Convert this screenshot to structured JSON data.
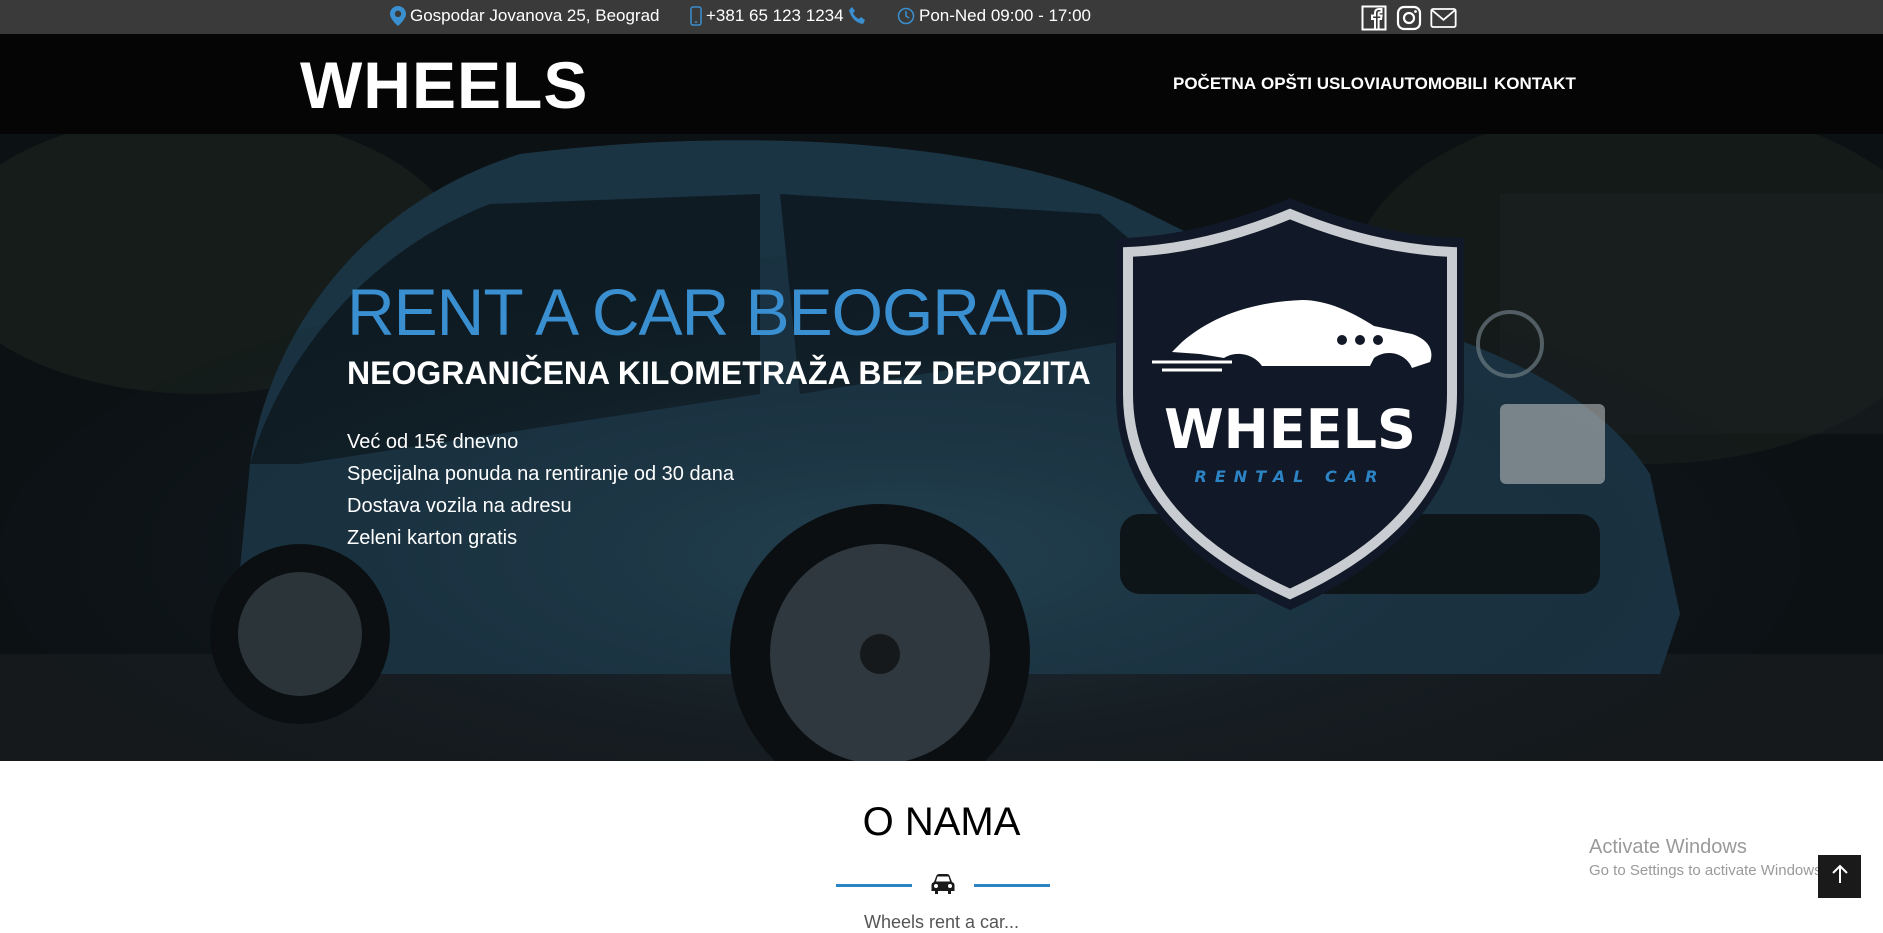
{
  "topbar": {
    "address": "Gospodar Jovanova 25, Beograd",
    "phone": "+381 65 123 1234",
    "hours": "Pon-Ned 09:00 - 17:00",
    "icons": [
      "location-pin-icon",
      "mobile-phone-icon",
      "phone-icon",
      "clock-icon"
    ],
    "social": [
      "facebook-icon",
      "instagram-icon",
      "mail-icon"
    ]
  },
  "navbar": {
    "brand": "WHEELS",
    "items": [
      "POČETNA",
      "OPŠTI USLOVI",
      "AUTOMOBILI",
      "KONTAKT"
    ]
  },
  "hero": {
    "title": "RENT A CAR BEOGRAD",
    "subtitle": "NEOGRANIČENA KILOMETRAŽA BEZ DEPOZITA",
    "features": [
      "Već od 15€ dnevno",
      "Specijalna ponuda na rentiranje od 30 dana",
      "Dostava vozila na adresu",
      "Zeleni karton gratis"
    ],
    "badge": {
      "name": "WHEELS",
      "tagline": "RENTAL CAR"
    }
  },
  "about": {
    "title": "O NAMA",
    "intro_fragment": "Wheels rent a car..."
  },
  "overlay": {
    "activate_title": "Activate Windows",
    "activate_sub": "Go to Settings to activate Windows."
  },
  "colors": {
    "accent": "#2d84c5",
    "topbar_bg": "#3a3a3a",
    "navbar_bg": "#050505"
  }
}
